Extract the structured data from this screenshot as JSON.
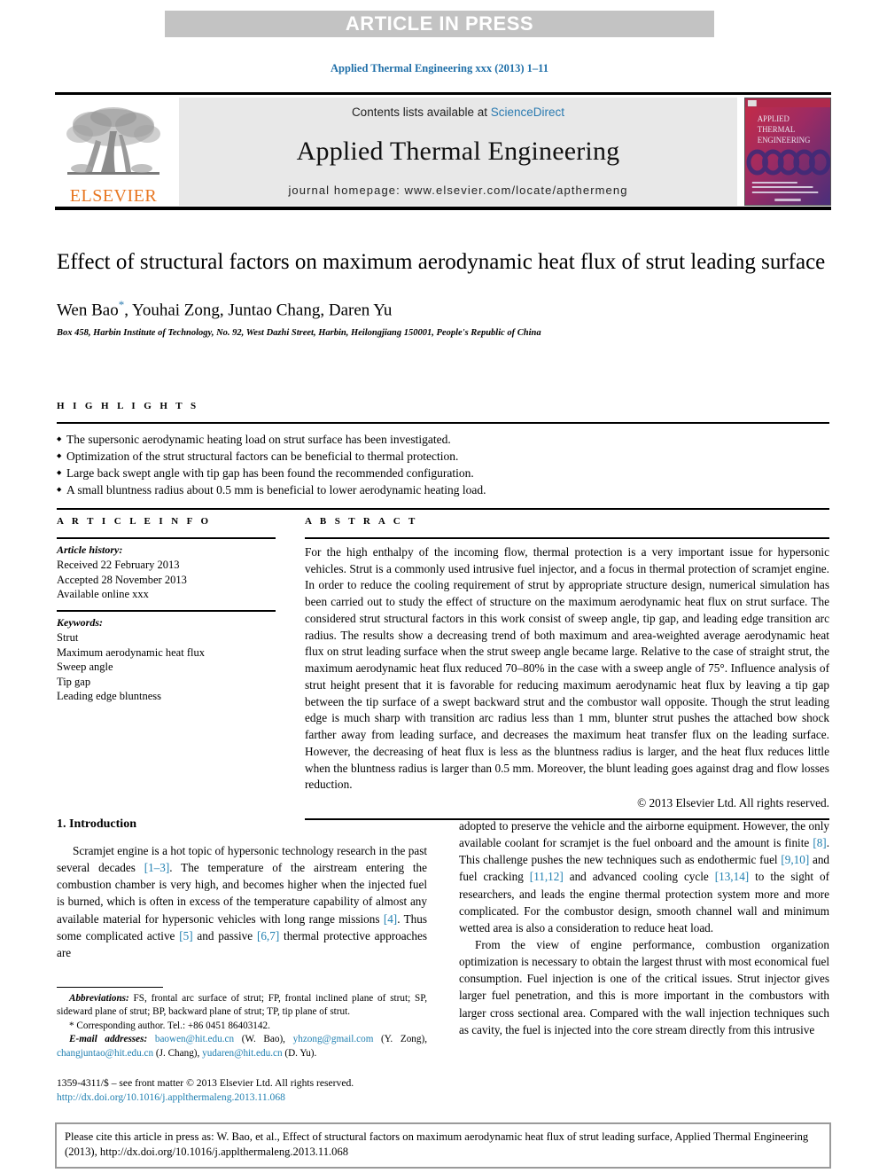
{
  "banner": {
    "label": "ARTICLE IN PRESS"
  },
  "running_head": "Applied Thermal Engineering xxx (2013) 1–11",
  "masthead": {
    "publisher_name": "ELSEVIER",
    "contents_prefix": "Contents lists available at ",
    "contents_link": "ScienceDirect",
    "journal_title": "Applied Thermal Engineering",
    "homepage_line": "journal homepage: www.elsevier.com/locate/apthermeng",
    "cover": {
      "line1": "APPLIED",
      "line2": "THERMAL",
      "line3": "ENGINEERING"
    }
  },
  "article": {
    "title": "Effect of structural factors on maximum aerodynamic heat flux of strut leading surface",
    "authors": "Wen Bao, Youhai Zong, Juntao Chang, Daren Yu",
    "corresponding_marker": "*",
    "affiliation": "Box 458, Harbin Institute of Technology, No. 92, West Dazhi Street, Harbin, Heilongjiang 150001, People's Republic of China"
  },
  "highlights": {
    "heading": "H I G H L I G H T S",
    "items": [
      "The supersonic aerodynamic heating load on strut surface has been investigated.",
      "Optimization of the strut structural factors can be beneficial to thermal protection.",
      "Large back swept angle with tip gap has been found the recommended configuration.",
      "A small bluntness radius about 0.5 mm is beneficial to lower aerodynamic heating load."
    ]
  },
  "article_info": {
    "heading": "A R T I C L E   I N F O",
    "history_label": "Article history:",
    "history": [
      "Received 22 February 2013",
      "Accepted 28 November 2013",
      "Available online xxx"
    ],
    "keywords_label": "Keywords:",
    "keywords": [
      "Strut",
      "Maximum aerodynamic heat flux",
      "Sweep angle",
      "Tip gap",
      "Leading edge bluntness"
    ]
  },
  "abstract": {
    "heading": "A B S T R A C T",
    "text": "For the high enthalpy of the incoming flow, thermal protection is a very important issue for hypersonic vehicles. Strut is a commonly used intrusive fuel injector, and a focus in thermal protection of scramjet engine. In order to reduce the cooling requirement of strut by appropriate structure design, numerical simulation has been carried out to study the effect of structure on the maximum aerodynamic heat flux on strut surface. The considered strut structural factors in this work consist of sweep angle, tip gap, and leading edge transition arc radius. The results show a decreasing trend of both maximum and area-weighted average aerodynamic heat flux on strut leading surface when the strut sweep angle became large. Relative to the case of straight strut, the maximum aerodynamic heat flux reduced 70–80% in the case with a sweep angle of 75°. Influence analysis of strut height present that it is favorable for reducing maximum aerodynamic heat flux by leaving a tip gap between the tip surface of a swept backward strut and the combustor wall opposite. Though the strut leading edge is much sharp with transition arc radius less than 1 mm, blunter strut pushes the attached bow shock farther away from leading surface, and decreases the maximum heat transfer flux on the leading surface. However, the decreasing of heat flux is less as the bluntness radius is larger, and the heat flux reduces little when the bluntness radius is larger than 0.5 mm. Moreover, the blunt leading goes against drag and flow losses reduction.",
    "copyright": "© 2013 Elsevier Ltd. All rights reserved."
  },
  "intro": {
    "heading": "1. Introduction",
    "left_para_1_a": "Scramjet engine is a hot topic of hypersonic technology research in the past several decades ",
    "left_ref_1": "[1–3]",
    "left_para_1_b": ". The temperature of the airstream entering the combustion chamber is very high, and becomes higher when the injected fuel is burned, which is often in excess of the temperature capability of almost any available material for hypersonic vehicles with long range missions ",
    "left_ref_2": "[4]",
    "left_para_1_c": ". Thus some complicated active ",
    "left_ref_3": "[5]",
    "left_para_1_d": " and passive ",
    "left_ref_4": "[6,7]",
    "left_para_1_e": " thermal protective approaches are",
    "right_para_1_a": "adopted to preserve the vehicle and the airborne equipment. However, the only available coolant for scramjet is the fuel onboard and the amount is finite ",
    "right_ref_1": "[8]",
    "right_para_1_b": ". This challenge pushes the new techniques such as endothermic fuel ",
    "right_ref_2": "[9,10]",
    "right_para_1_c": " and fuel cracking ",
    "right_ref_3": "[11,12]",
    "right_para_1_d": " and advanced cooling cycle ",
    "right_ref_4": "[13,14]",
    "right_para_1_e": " to the sight of researchers, and leads the engine thermal protection system more and more complicated. For the combustor design, smooth channel wall and minimum wetted area is also a consideration to reduce heat load.",
    "right_para_2": "From the view of engine performance, combustion organization optimization is necessary to obtain the largest thrust with most economical fuel consumption. Fuel injection is one of the critical issues. Strut injector gives larger fuel penetration, and this is more important in the combustors with larger cross sectional area. Compared with the wall injection techniques such as cavity, the fuel is injected into the core stream directly from this intrusive"
  },
  "footnotes": {
    "abbrev_label": "Abbreviations:",
    "abbrev_text": " FS, frontal arc surface of strut; FP, frontal inclined plane of strut; SP, sideward plane of strut; BP, backward plane of strut; TP, tip plane of strut.",
    "corresponding": "* Corresponding author. Tel.: +86 0451 86403142.",
    "email_label": "E-mail addresses:",
    "email_1": "baowen@hit.edu.cn",
    "email_1_who": " (W. Bao), ",
    "email_2": "yhzong@gmail.com",
    "email_2_who": " (Y. Zong), ",
    "email_3": "changjuntao@hit.edu.cn",
    "email_3_who": " (J. Chang), ",
    "email_4": "yudaren@hit.edu.cn",
    "email_4_who": " (D. Yu).",
    "issn_line": "1359-4311/$ – see front matter © 2013 Elsevier Ltd. All rights reserved.",
    "doi_line": "http://dx.doi.org/10.1016/j.applthermaleng.2013.11.068"
  },
  "cite_box": {
    "text": "Please cite this article in press as: W. Bao, et al., Effect of structural factors on maximum aerodynamic heat flux of strut leading surface, Applied Thermal Engineering (2013), http://dx.doi.org/10.1016/j.applthermaleng.2013.11.068"
  },
  "colors": {
    "link_blue": "#1f7fb0",
    "elsevier_orange": "#e87722",
    "banner_gray": "#c3c3c3",
    "journal_box_gray": "#e8e8e8"
  }
}
